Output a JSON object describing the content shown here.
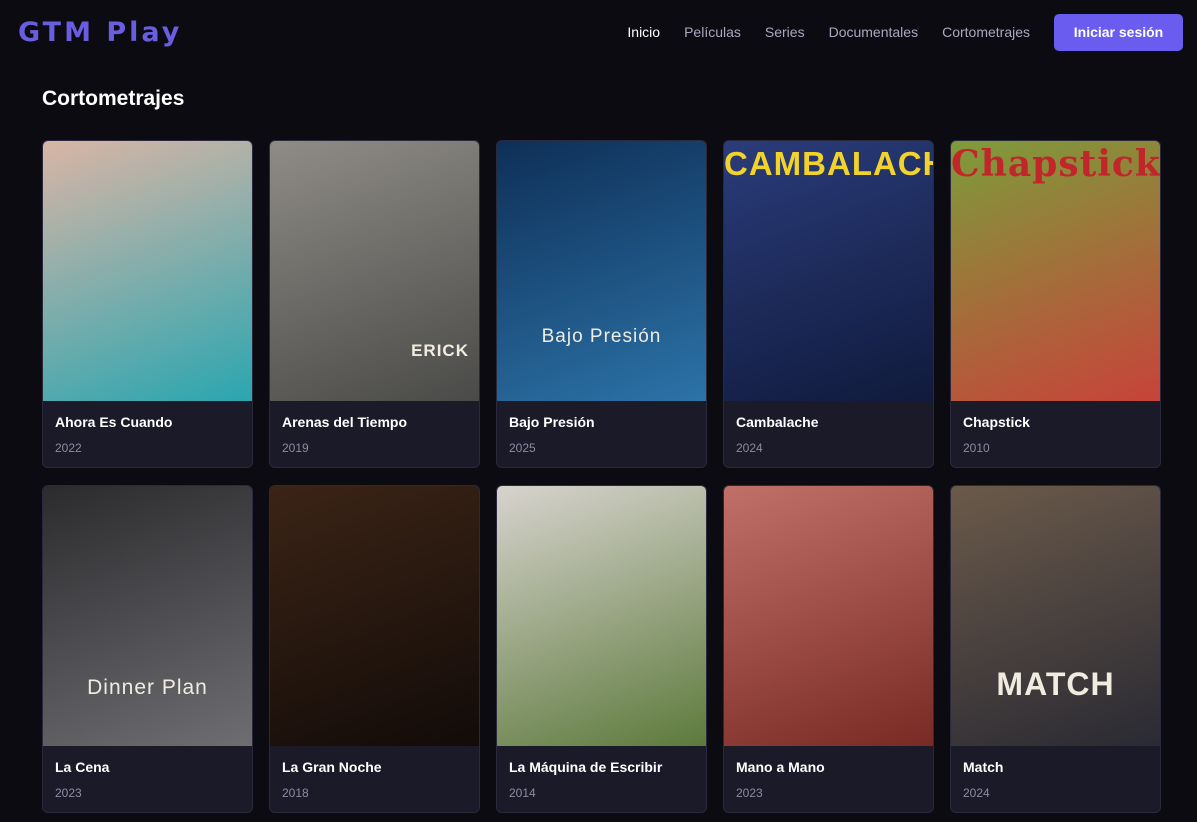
{
  "header": {
    "logo": "GTM Play",
    "nav": [
      {
        "label": "Inicio",
        "active": true
      },
      {
        "label": "Películas",
        "active": false
      },
      {
        "label": "Series",
        "active": false
      },
      {
        "label": "Documentales",
        "active": false
      },
      {
        "label": "Cortometrajes",
        "active": false
      }
    ],
    "login_label": "Iniciar sesión",
    "accent_color": "#6b5cf0"
  },
  "section": {
    "title": "Cortometrajes"
  },
  "movies": [
    {
      "title": "Ahora Es Cuando",
      "year": "2022",
      "poster_text": "",
      "colors": [
        "#d9b5a6",
        "#2aa6b0"
      ]
    },
    {
      "title": "Arenas del Tiempo",
      "year": "2019",
      "poster_text": "ERICK",
      "colors": [
        "#8f8c86",
        "#4a4a48"
      ]
    },
    {
      "title": "Bajo Presión",
      "year": "2025",
      "poster_text": "Bajo Presión",
      "colors": [
        "#0e2f57",
        "#2c73a8"
      ]
    },
    {
      "title": "Cambalache",
      "year": "2024",
      "poster_text": "CAMBALACHE",
      "colors": [
        "#2a3c7a",
        "#101a3c"
      ]
    },
    {
      "title": "Chapstick",
      "year": "2010",
      "poster_text": "Chapstick",
      "colors": [
        "#7d9c3a",
        "#c7433a"
      ]
    },
    {
      "title": "La Cena",
      "year": "2023",
      "poster_text": "Dinner Plan",
      "colors": [
        "#2b2b2e",
        "#6e6e72"
      ]
    },
    {
      "title": "La Gran Noche",
      "year": "2018",
      "poster_text": "",
      "colors": [
        "#3b2416",
        "#120b08"
      ]
    },
    {
      "title": "La Máquina de Escribir",
      "year": "2014",
      "poster_text": "",
      "colors": [
        "#d7d3ce",
        "#5d7a3c"
      ]
    },
    {
      "title": "Mano a Mano",
      "year": "2023",
      "poster_text": "",
      "colors": [
        "#c07068",
        "#7a2a24"
      ]
    },
    {
      "title": "Match",
      "year": "2024",
      "poster_text": "MATCH",
      "colors": [
        "#6b5a4a",
        "#2a2a33"
      ]
    }
  ]
}
